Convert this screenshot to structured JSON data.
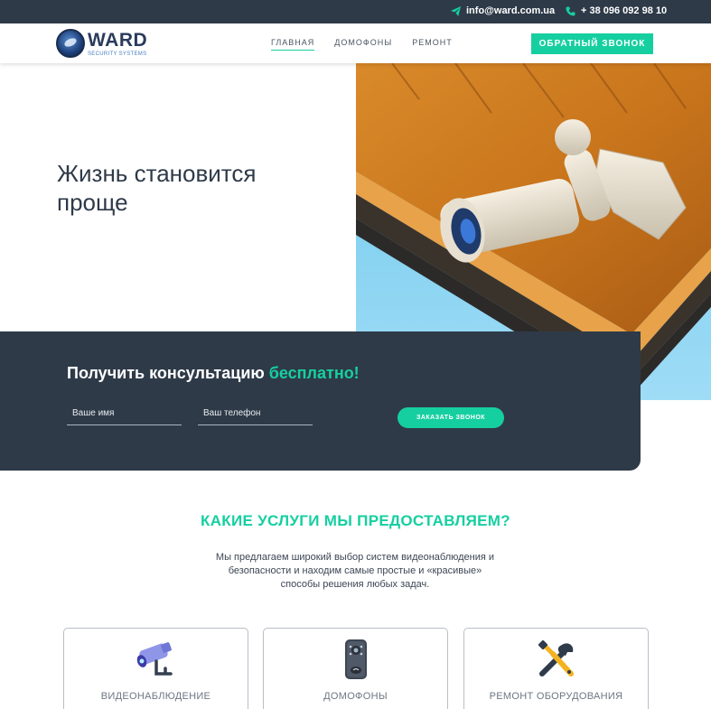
{
  "topbar": {
    "email": "info@ward.com.ua",
    "phone": "+ 38 096 092 98 10"
  },
  "logo": {
    "title": "WARD",
    "subtitle": "SECURITY SYSTEMS"
  },
  "nav": {
    "items": [
      {
        "label": "ГЛАВНАЯ",
        "active": true
      },
      {
        "label": "ДОМОФОНЫ",
        "active": false
      },
      {
        "label": "РЕМОНТ",
        "active": false
      }
    ],
    "callback_label": "ОБРАТНЫЙ ЗВОНОК"
  },
  "hero": {
    "title": "Жизнь становится проще"
  },
  "consult": {
    "title_main": "Получить консультацию",
    "title_accent": "бесплатно!",
    "name_placeholder": "Ваше имя",
    "phone_placeholder": "Ваш телефон",
    "submit_label": "ЗАКАЗАТЬ ЗВОНОК"
  },
  "services": {
    "title": "КАКИЕ УСЛУГИ МЫ ПРЕДОСТАВЛЯЕМ?",
    "description": "Мы предлагаем широкий выбор систем видеонаблюдения и безопасности и находим самые простые и «красивые» способы решения любых задач.",
    "cards": [
      {
        "label": "ВИДЕОНАБЛЮДЕНИЕ",
        "icon": "cctv-camera-icon"
      },
      {
        "label": "ДОМОФОНЫ",
        "icon": "intercom-icon"
      },
      {
        "label": "РЕМОНТ ОБОРУДОВАНИЯ",
        "icon": "tools-icon"
      }
    ]
  },
  "colors": {
    "accent": "#16cfa0",
    "dark": "#2e3a48"
  }
}
